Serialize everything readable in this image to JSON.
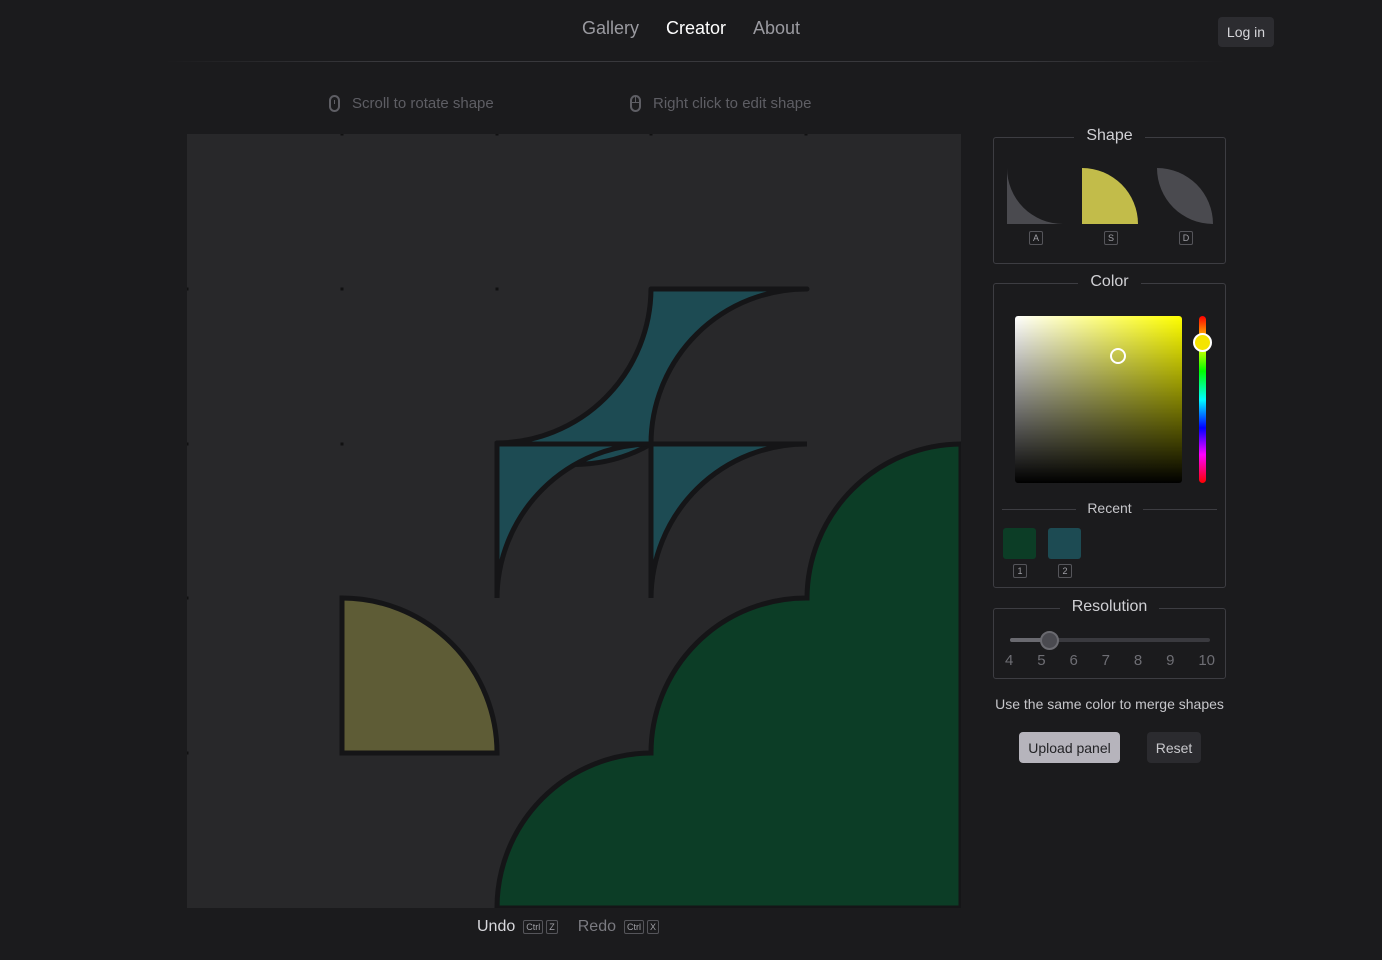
{
  "nav": {
    "links": [
      "Gallery",
      "Creator",
      "About"
    ],
    "active": "Creator",
    "login_label": "Log in"
  },
  "hints": {
    "scroll": "Scroll to rotate shape",
    "right_click": "Right click to edit shape"
  },
  "canvas": {
    "background": "#28282a",
    "colors": {
      "teal": "#1d4b53",
      "olive": "#5e5c36",
      "green": "#0c3d26",
      "outline": "#151517"
    }
  },
  "history": {
    "undo_label": "Undo",
    "undo_keys": [
      "Ctrl",
      "Z"
    ],
    "redo_label": "Redo",
    "redo_keys": [
      "Ctrl",
      "X"
    ]
  },
  "shape_panel": {
    "title": "Shape",
    "options": [
      {
        "key": "A",
        "icon": "concave-corner-shape-icon",
        "color": "#4a4a4f"
      },
      {
        "key": "S",
        "icon": "quarter-circle-shape-icon",
        "color": "#c2bc4a",
        "selected": true
      },
      {
        "key": "D",
        "icon": "leaf-shape-icon",
        "color": "#4a4a4f"
      }
    ]
  },
  "color_panel": {
    "title": "Color",
    "current_hue": "#ffff00",
    "recent_title": "Recent",
    "recent": [
      {
        "key": "1",
        "color": "#0c3d26"
      },
      {
        "key": "2",
        "color": "#1d4b53"
      }
    ]
  },
  "resolution_panel": {
    "title": "Resolution",
    "ticks": [
      "4",
      "5",
      "6",
      "7",
      "8",
      "9",
      "10"
    ],
    "value": 5
  },
  "merge_note": "Use the same color to merge shapes",
  "buttons": {
    "upload": "Upload panel",
    "reset": "Reset"
  }
}
